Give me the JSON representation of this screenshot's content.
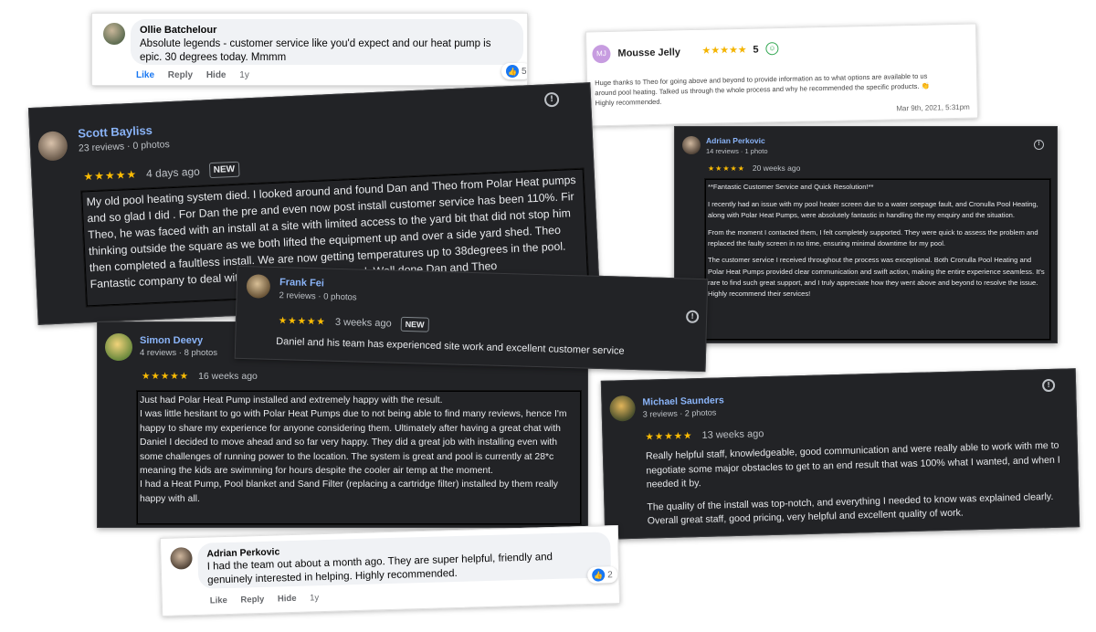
{
  "ollie": {
    "name": "Ollie Batchelour",
    "text": "Absolute legends - customer service like you'd expect and our heat pump is epic. 30 degrees today. Mmmm",
    "actions": [
      "Like",
      "Reply",
      "Hide"
    ],
    "time": "1y",
    "reactions": "5",
    "reaction_icon": "like-icon"
  },
  "mousse": {
    "name": "Mousse Jelly",
    "avatar_initials": "MJ",
    "stars": "★★★★★",
    "rating": "5",
    "rating_icon": "smiley-icon",
    "text": "Huge thanks to Theo for going above and beyond to provide information as to what options are available to us around pool heating. Talked us through the whole process and why he recommended the specific products. 👏 Highly recommended.",
    "date": "Mar 9th, 2021, 5:31pm"
  },
  "scott": {
    "name": "Scott Bayliss",
    "meta": "23 reviews · 0 photos",
    "stars": "★★★★★",
    "ago": "4 days ago",
    "badge": "NEW",
    "text": "My old pool heating system died. I looked around and found Dan and Theo from Polar Heat pumps and so glad I did . For Dan the pre and even now post install customer service has been 110%. Fir Theo, he was faced with an install at a site with limited access to the yard bit that did not stop him thinking outside the square as we both lifted the equipment up and over a side yard shed. Theo then completed a faultless install. We are now getting temperatures up to 38degrees in the pool. Fantastic company to deal with and I highly recommend. Well done Dan and Theo"
  },
  "adrian_dark": {
    "name": "Adrian Perkovic",
    "meta": "14 reviews · 1 photo",
    "stars": "★★★★★",
    "ago": "20 weeks ago",
    "p1": "**Fantastic Customer Service and Quick Resolution!**",
    "p2": "I recently had an issue with my pool heater screen due to a water seepage fault, and Cronulla Pool Heating, along with Polar Heat Pumps, were absolutely fantastic in handling the my enquiry and the situation.",
    "p3": "From the moment I contacted them, I felt completely supported. They were quick to assess the problem and replaced the faulty screen in no time, ensuring minimal downtime for my pool.",
    "p4": "The customer service I received throughout the process was exceptional. Both Cronulla Pool Heating and Polar Heat Pumps provided clear communication and swift action, making the entire experience seamless. It's rare to find such great support, and I truly appreciate how they went above and beyond to resolve the issue. Highly recommend their services!"
  },
  "frank": {
    "name": "Frank Fei",
    "meta": "2 reviews · 0 photos",
    "stars": "★★★★★",
    "ago": "3 weeks ago",
    "badge": "NEW",
    "text": "Daniel and his team has experienced site work and excellent customer service"
  },
  "simon": {
    "name": "Simon Deevy",
    "meta": "4 reviews · 8 photos",
    "stars": "★★★★★",
    "ago": "16 weeks ago",
    "p1": "Just had Polar Heat Pump installed and extremely happy with the result.",
    "p2": "I was little hesitant to go with Polar Heat Pumps due to not being able to find many reviews, hence I'm happy to share my experience for anyone considering them. Ultimately after having a great chat with Daniel I decided to move ahead and so far very happy. They did a great job with installing even with some challenges of running power to the location. The system is great and pool is currently at 28*c meaning the kids are swimming for hours despite the cooler air temp at the moment.",
    "p3": "I had a Heat Pump, Pool blanket and Sand Filter (replacing a cartridge filter) installed by them really happy with all."
  },
  "michael": {
    "name": "Michael Saunders",
    "meta": "3 reviews · 2 photos",
    "stars": "★★★★★",
    "ago": "13 weeks ago",
    "p1": "Really helpful staff, knowledgeable, good communication and were really able to work with me to negotiate some major obstacles to get to an end result that was 100% what I wanted, and when I needed it by.",
    "p2": "The quality of the install was top-notch, and everything I needed to know was explained clearly.",
    "p3": "Overall great staff, good pricing, very helpful and excellent quality of work."
  },
  "adrian_fb": {
    "name": "Adrian Perkovic",
    "text": "I had the team out about a month ago. They are super helpful, friendly and genuinely interested in helping. Highly recommended.",
    "actions": [
      "Like",
      "Reply",
      "Hide"
    ],
    "time": "1y",
    "reactions": "2",
    "reaction_icon": "like-icon"
  },
  "icons": {
    "info": "info-icon",
    "star": "star-icon",
    "like": "like-icon"
  }
}
